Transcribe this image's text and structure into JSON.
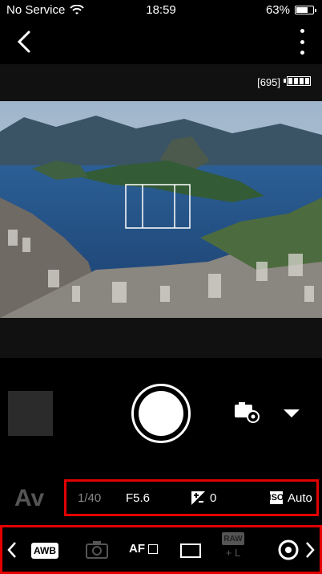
{
  "status_bar": {
    "carrier": "No Service",
    "time": "18:59",
    "battery_percent": "63%",
    "battery_level": 0.63,
    "icons": [
      "wifi-icon",
      "battery-icon"
    ]
  },
  "nav": {
    "icons": [
      "back-chevron-icon",
      "more-vertical-icon"
    ]
  },
  "camera_header": {
    "remaining_shots": "[695]",
    "battery_icon": "camera-battery-icon"
  },
  "preview": {
    "focus_icon": "af-frame-icon"
  },
  "controls": {
    "icons": [
      "camera-settings-icon",
      "dropdown-triangle-icon"
    ]
  },
  "exposure": {
    "mode": "Av",
    "shutter": "1/40",
    "aperture": "F5.6",
    "compensation": "0",
    "iso_label": "ISO",
    "iso_value": "Auto"
  },
  "bottom_bar": {
    "awb": "AWB",
    "af": "AF",
    "raw": "RAW",
    "quality": "+ L",
    "icons": [
      "chevron-left-icon",
      "picture-style-icon",
      "af-mode-icon",
      "aspect-ratio-icon",
      "image-quality-icon",
      "metering-icon",
      "chevron-right-icon"
    ]
  },
  "colors": {
    "highlight": "#e20000",
    "background": "#000000",
    "text": "#ffffff",
    "muted": "#555555"
  }
}
